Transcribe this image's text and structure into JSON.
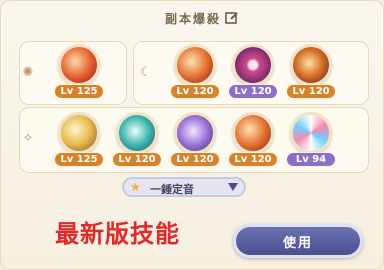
{
  "header": {
    "title": "副本爆殺"
  },
  "rows": [
    {
      "name": "sun",
      "skills": [
        {
          "level": "Lv 125",
          "style": "fire",
          "badge": "orange"
        }
      ]
    },
    {
      "name": "moon",
      "skills": [
        {
          "level": "Lv 120",
          "style": "fire",
          "badge": "orange"
        },
        {
          "level": "Lv 120",
          "style": "target",
          "badge": "purple"
        },
        {
          "level": "Lv 120",
          "style": "vortex",
          "badge": "orange"
        }
      ]
    },
    {
      "name": "star",
      "skills": [
        {
          "level": "Lv 125",
          "style": "wind",
          "badge": "orange"
        },
        {
          "level": "Lv 120",
          "style": "teal",
          "badge": "orange"
        },
        {
          "level": "Lv 120",
          "style": "violet",
          "badge": "orange"
        },
        {
          "level": "Lv 120",
          "style": "fire",
          "badge": "orange"
        },
        {
          "level": "Lv 94",
          "style": "swirl",
          "badge": "purple"
        }
      ]
    }
  ],
  "dropdown": {
    "selected": "一錘定音"
  },
  "overlay_text": "最新版技能",
  "use_button": {
    "label": "使用"
  },
  "colors": {
    "badge_orange": "#d8822a",
    "badge_purple": "#8b6fc8",
    "button": "#5a5f9e",
    "red_text": "#e0282a"
  }
}
